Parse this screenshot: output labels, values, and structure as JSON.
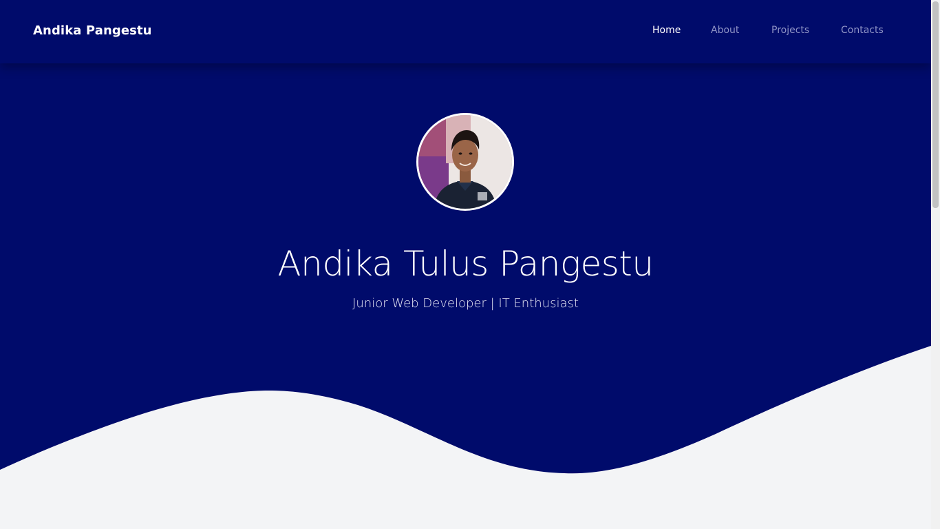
{
  "navbar": {
    "brand": "Andika Pangestu",
    "links": [
      {
        "label": "Home",
        "active": true
      },
      {
        "label": "About",
        "active": false
      },
      {
        "label": "Projects",
        "active": false
      },
      {
        "label": "Contacts",
        "active": false
      }
    ]
  },
  "hero": {
    "name": "Andika Tulus Pangestu",
    "subtitle": "Junior Web Developer | IT Enthusiast"
  },
  "colors": {
    "primary": "#000b6b",
    "background": "#f3f4f6",
    "text_light": "#ffffff",
    "nav_inactive": "#8f95c6"
  }
}
